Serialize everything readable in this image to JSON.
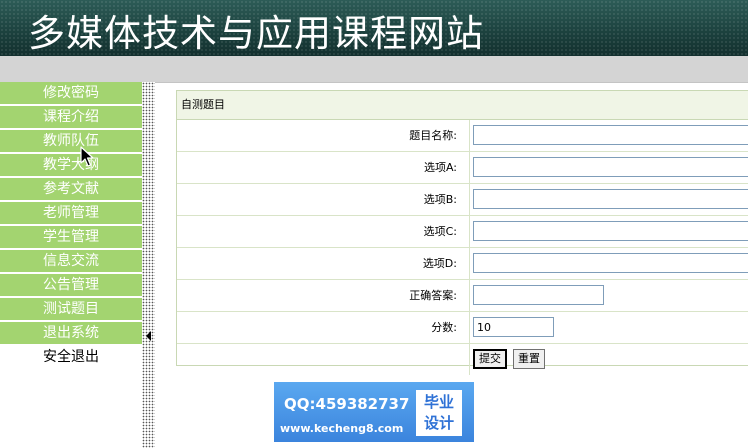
{
  "header": {
    "title": "多媒体技术与应用课程网站"
  },
  "sidebar": {
    "items": [
      {
        "label": "修改密码"
      },
      {
        "label": "课程介绍"
      },
      {
        "label": "教师队伍"
      },
      {
        "label": "教学大纲"
      },
      {
        "label": "参考文献"
      },
      {
        "label": "老师管理"
      },
      {
        "label": "学生管理"
      },
      {
        "label": "信息交流"
      },
      {
        "label": "公告管理"
      },
      {
        "label": "测试题目"
      },
      {
        "label": "退出系统"
      }
    ],
    "logout_label": "安全退出"
  },
  "form": {
    "title": "自测题目",
    "fields": {
      "question": {
        "label": "题目名称:",
        "value": ""
      },
      "option_a": {
        "label": "选项A:",
        "value": ""
      },
      "option_b": {
        "label": "选项B:",
        "value": ""
      },
      "option_c": {
        "label": "选项C:",
        "value": ""
      },
      "option_d": {
        "label": "选项D:",
        "value": ""
      },
      "answer": {
        "label": "正确答案:",
        "value": ""
      },
      "score": {
        "label": "分数:",
        "value": "10"
      }
    },
    "submit_label": "提交",
    "reset_label": "重置"
  },
  "ad": {
    "qq": "QQ:459382737",
    "url": "www.kecheng8.com",
    "badge_line1": "毕业",
    "badge_line2": "设计"
  },
  "colors": {
    "banner": "#1f4643",
    "sidebar_item": "#a3d470",
    "panel_border": "#c9d8b4",
    "ad_background": "#3f8ae0"
  },
  "icons": {
    "collapse_toggle": "triangle-left-icon",
    "cursor": "mouse-pointer-icon"
  }
}
